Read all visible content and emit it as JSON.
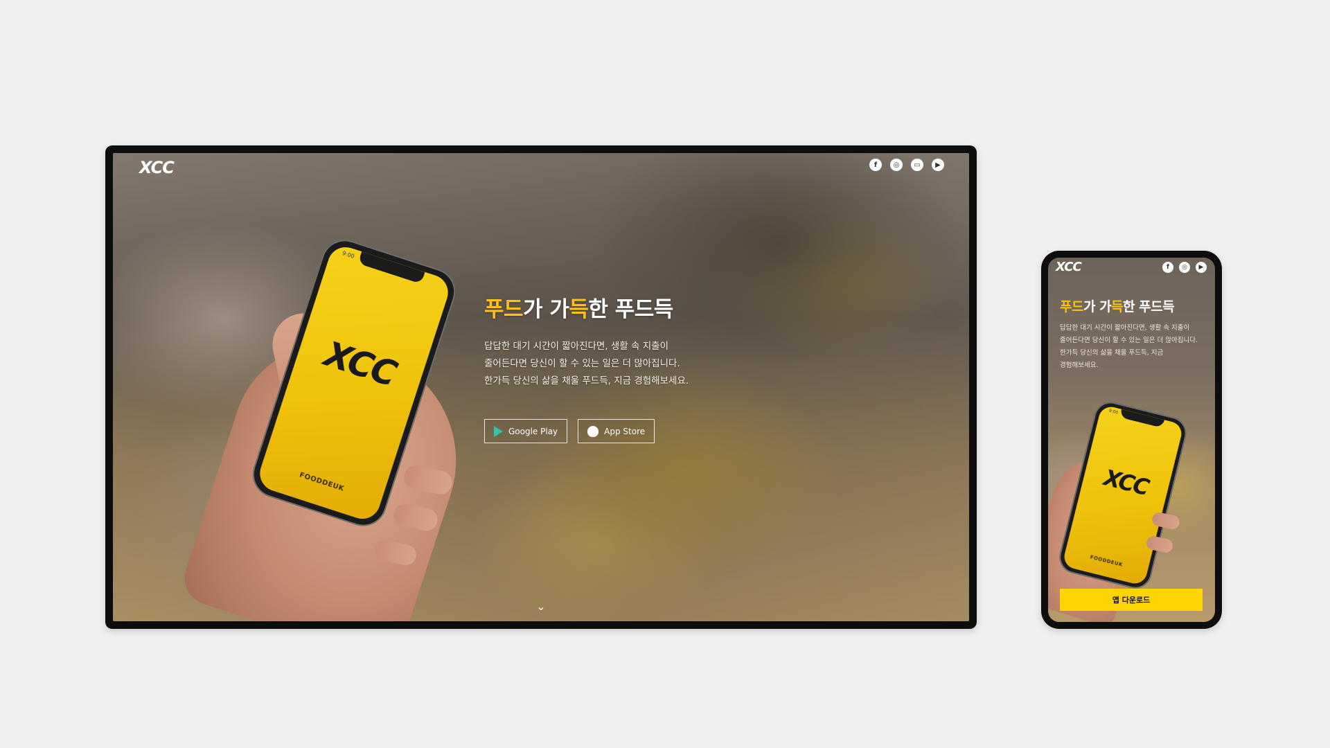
{
  "brand": {
    "logo_text": "XCC",
    "app_name": "FOODDEUK",
    "accent_color": "#ffc21a",
    "button_color": "#ffd400"
  },
  "desktop": {
    "social_icons": [
      "facebook-icon",
      "instagram-icon",
      "chat-icon",
      "youtube-icon"
    ],
    "social_glyphs": [
      "f",
      "◎",
      "▭",
      "▶"
    ],
    "phone_time": "9:00",
    "hero": {
      "title_parts": [
        "푸드",
        "가 가",
        "득",
        "한 푸드득"
      ],
      "desc_lines": [
        "답답한 대기 시간이 짧아진다면, 생활 속 지출이",
        "줄어든다면 당신이 할 수 있는 일은 더 많아집니다.",
        "한가득 당신의 삶을 채울 푸드득, 지금 경험해보세요."
      ]
    },
    "buttons": {
      "google_play": "Google Play",
      "app_store": "App Store"
    },
    "scroll_chevron": "⌄"
  },
  "mobile": {
    "social_icons": [
      "facebook-icon",
      "instagram-icon",
      "youtube-icon"
    ],
    "social_glyphs": [
      "f",
      "◎",
      "▶"
    ],
    "phone_time": "9:00",
    "hero": {
      "title_parts": [
        "푸드",
        "가 가",
        "득",
        "한 푸드득"
      ],
      "desc_lines": [
        "답답한 대기 시간이 짧아진다면, 생활 속 지출이",
        "줄어든다면 당신이 할 수 있는 일은 더 많아집니다.",
        "한가득 당신의 삶을 채울 푸드득, 지금",
        "경험해보세요."
      ]
    },
    "download_button": "앱 다운로드"
  }
}
